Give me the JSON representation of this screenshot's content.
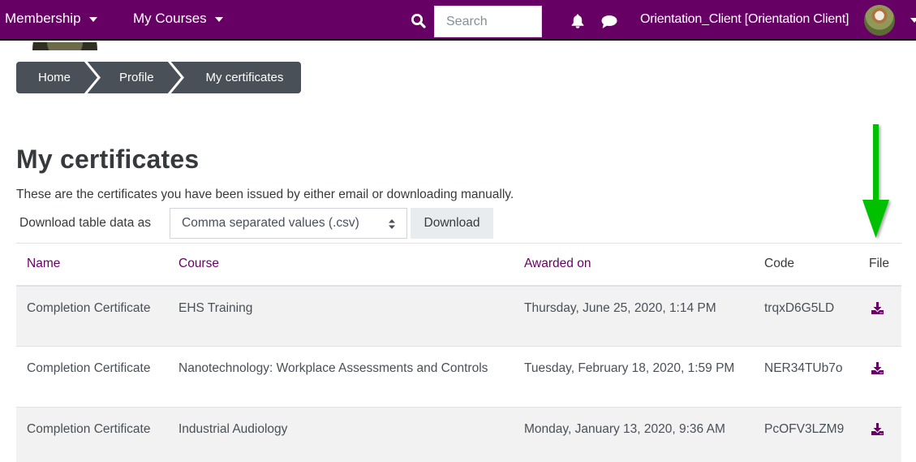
{
  "navbar": {
    "menus": [
      {
        "label": "Membership"
      },
      {
        "label": "My Courses"
      }
    ],
    "search": {
      "placeholder": "Search",
      "value": ""
    },
    "user": {
      "name": "Orientation_Client [Orientation Client]"
    },
    "icons": [
      "search-icon",
      "bell-icon",
      "chat-icon",
      "avatar",
      "chevron-down-icon"
    ],
    "brand_color": "#670064"
  },
  "breadcrumb": [
    {
      "label": "Home"
    },
    {
      "label": "Profile"
    },
    {
      "label": "My certificates"
    }
  ],
  "page": {
    "title": "My certificates",
    "intro": "These are the certificates you have been issued by either email or downloading manually."
  },
  "download": {
    "label": "Download table data as",
    "format_selected": "Comma separated values (.csv)",
    "button_label": "Download"
  },
  "table": {
    "columns": [
      {
        "label": "Name",
        "sortable": true
      },
      {
        "label": "Course",
        "sortable": true
      },
      {
        "label": "Awarded on",
        "sortable": true
      },
      {
        "label": "Code",
        "sortable": false
      },
      {
        "label": "File",
        "sortable": false
      }
    ],
    "rows": [
      {
        "name": "Completion Certificate",
        "course": "EHS Training",
        "awarded_on": "Thursday, June 25, 2020, 1:14 PM",
        "code": "trqxD6G5LD",
        "file_icon": "download-icon"
      },
      {
        "name": "Completion Certificate",
        "course": "Nanotechnology: Workplace Assessments and Controls",
        "awarded_on": "Tuesday, February 18, 2020, 1:59 PM",
        "code": "NER34TUb7o",
        "file_icon": "download-icon"
      },
      {
        "name": "Completion Certificate",
        "course": "Industrial Audiology",
        "awarded_on": "Monday, January 13, 2020, 9:36 AM",
        "code": "PcOFV3LZM9",
        "file_icon": "download-icon"
      }
    ]
  },
  "annotation": {
    "type": "arrow-down",
    "color": "#00c000",
    "points_to": "File column"
  }
}
